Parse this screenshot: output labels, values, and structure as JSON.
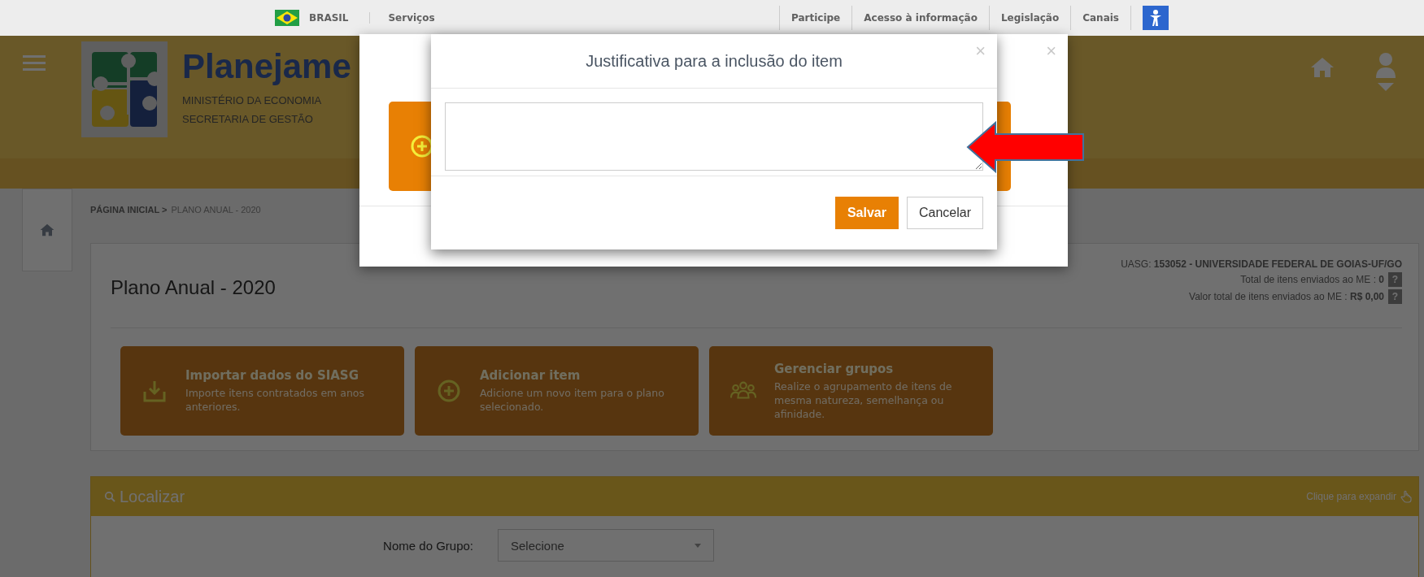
{
  "gov_bar": {
    "country": "BRASIL",
    "left_links": [
      "Serviços"
    ],
    "right_links": [
      "Participe",
      "Acesso à informação",
      "Legislação",
      "Canais"
    ]
  },
  "header": {
    "title": "Planejame",
    "subtitle_lines": [
      "MINISTÉRIO DA ECONOMIA",
      "SECRETARIA DE GESTÃO"
    ]
  },
  "breadcrumb": [
    {
      "label": "PÁGINA INICIAL >",
      "current": false
    },
    {
      "label": "PLANO ANUAL - 2020",
      "current": true
    }
  ],
  "plan": {
    "title": "Plano Anual - 2020",
    "uasg": "UASG: **153052 - UNIVERSIDADE FEDERAL DE GOIAS-UF/GO**",
    "stats": [
      {
        "text": "Total de itens enviados ao ME : **0**",
        "help": "?"
      },
      {
        "text": "Valor total de itens enviados ao ME : **R$ 0,00**",
        "help": "?"
      }
    ]
  },
  "actions": [
    {
      "kind": "import",
      "title": "Importar dados do SIASG",
      "description": "Importe itens contratados em anos anteriores."
    },
    {
      "kind": "add",
      "title": "Adicionar item",
      "description": "Adicione um novo item para o plano selecionado."
    },
    {
      "kind": "groups",
      "title": "Gerenciar grupos",
      "description": "Realize o agrupamento de itens de mesma natureza, semelhança ou afinidade."
    }
  ],
  "search_panel": {
    "title": "Localizar",
    "expand_hint": "Clique para expandir",
    "fields": [
      {
        "label": "Nome do Grupo:",
        "value": "Selecione"
      }
    ]
  },
  "back_dialog": {
    "close": "×"
  },
  "dialog": {
    "title": "Justificativa para a inclusão do item",
    "close": "×",
    "buttons": [
      {
        "label": "Salvar",
        "primary": true
      },
      {
        "label": "Cancelar",
        "primary": false
      }
    ]
  }
}
